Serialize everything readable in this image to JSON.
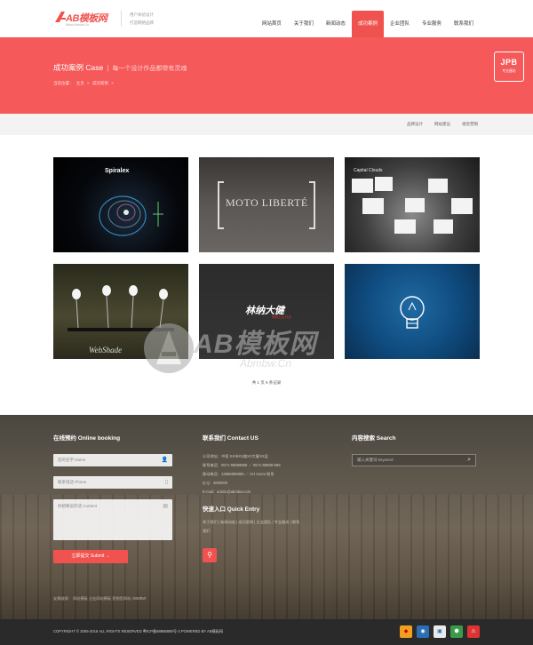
{
  "header": {
    "logo_text": "AB模板网",
    "logo_sub": "Www.Abmbw.Cn",
    "slogan_line1": "用户体验设计",
    "slogan_line2": "打造网络品牌",
    "nav": [
      "网站首页",
      "关于我们",
      "新闻动态",
      "成功案例",
      "企业团队",
      "专业服务",
      "联系我们"
    ],
    "active_nav_index": 3
  },
  "banner": {
    "title": "成功案例 Case",
    "subtitle": "每一个设计作品都带有灵魂",
    "breadcrumb": [
      "当前位置：",
      "主页",
      ">",
      "成功案例",
      ">"
    ],
    "badge_big": "JPB",
    "badge_small": "专业建站"
  },
  "subnav": [
    "品牌设计",
    "网站建设",
    "视觉营销"
  ],
  "gallery": {
    "tile1_text": "Spiralex",
    "tile2_text": "MOTO LIBERTÉ",
    "tile3_text": "Capital Clouds",
    "tile4_text": "WebShade",
    "tile5_text": "林纳大健",
    "tile5_sub": "健康生活 科技",
    "pager": "共 1 页 6 条记录"
  },
  "watermark": {
    "text": "AB模板网",
    "sub": "Abmbw.Cn"
  },
  "footer": {
    "booking": {
      "title": "在线预约 Online booking",
      "name_placeholder": "您的名字 Name",
      "phone_placeholder": "联系电话 Phone",
      "content_placeholder": "你想要说的话 Content",
      "submit": "立即提交 Submit →"
    },
    "contact": {
      "title": "联系我们 Contact US",
      "lines": [
        "公司地址：中国 XX市XX路XX大厦XX层",
        "联系电话：0571-88888888  ／  0571-88888-888",
        "移动电话：13888888888  ／  CH  Anum  联系",
        "Q  Q：4000000",
        "E-mail：admin@abmbw.com"
      ],
      "quick_title": "快速入口 Quick Entry",
      "quick_links": [
        "关于我们",
        "新闻动态",
        "成功案例",
        "企业团队",
        "专业服务",
        "联系",
        "我们"
      ]
    },
    "search": {
      "title": "内容搜索 Search",
      "placeholder": "输入关键词 keyword"
    },
    "friend_links": "友情链接：   网站模板   企业网站模板   营销型网站   ABMBW"
  },
  "bottombar": {
    "copyright": "COPYRIGHT © 2005-2015 ALL RIGHTS RESERVED  粤ICP备88888888号-2  POWERED BY AB模板网",
    "certs": [
      "◆",
      "◉",
      "▣",
      "⬢",
      "⚠"
    ]
  }
}
